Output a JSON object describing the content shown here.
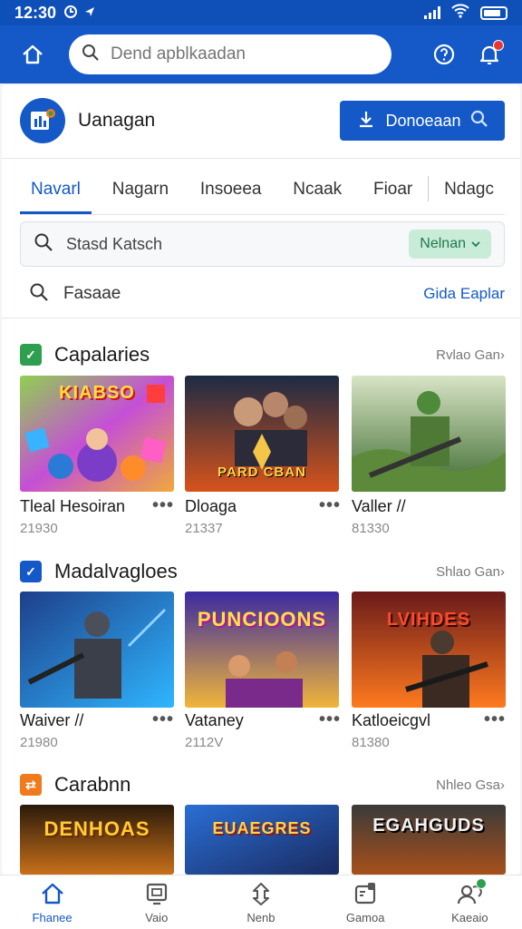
{
  "status_bar": {
    "time": "12:30",
    "accent": "#0e4fb8"
  },
  "app_bar": {
    "search_placeholder": "Dend apblkaadan",
    "icons": [
      "back-home-icon",
      "search-icon",
      "help-icon",
      "notification-icon"
    ]
  },
  "header": {
    "app_name": "Uanagan",
    "download_label": "Donoeaan"
  },
  "tabs": [
    "Navarl",
    "Nagarn",
    "Insoeea",
    "Ncaak",
    "Fioar",
    "Ndagc"
  ],
  "filter": {
    "placeholder": "Stasd Katsch",
    "chip_label": "Nelnan"
  },
  "row2": {
    "label": "Fasaae",
    "link": "Gida Eaplar"
  },
  "sections": [
    {
      "title": "Capalaries",
      "see_all": "Rvlao Gan›",
      "icon_color": "#2e9e4f",
      "games": [
        {
          "name": "Tleal Hesoiran",
          "count": "21930",
          "banner": "KIABSO"
        },
        {
          "name": "Dloaga",
          "count": "21337",
          "banner": "PARD CBAN"
        },
        {
          "name": "Valler //",
          "count": "81330",
          "banner": ""
        }
      ]
    },
    {
      "title": "Madalvagloes",
      "see_all": "Shlao Gan›",
      "icon_color": "#1459c7",
      "games": [
        {
          "name": "Waiver //",
          "count": "21980",
          "banner": ""
        },
        {
          "name": "Vataney",
          "count": "2112V",
          "banner": "PUNCIOONS"
        },
        {
          "name": "Katloeicgvl",
          "count": "81380",
          "banner": "LVIHDES"
        }
      ]
    },
    {
      "title": "Carabnn",
      "see_all": "Nhleo Gsa›",
      "icon_color": "#f07a1c",
      "games": [
        {
          "name": "",
          "count": "",
          "banner": "DENHOAS"
        },
        {
          "name": "",
          "count": "",
          "banner": "EUAEGRES"
        },
        {
          "name": "",
          "count": "",
          "banner": "EGAHGUDS"
        }
      ]
    }
  ],
  "bottom_nav": [
    {
      "label": "Fhanee",
      "icon": "home-icon",
      "active": true
    },
    {
      "label": "Vaio",
      "icon": "tv-icon",
      "active": false
    },
    {
      "label": "Nenb",
      "icon": "puzzle-icon",
      "active": false
    },
    {
      "label": "Gamoa",
      "icon": "gamepad-icon",
      "active": false
    },
    {
      "label": "Kaeaio",
      "icon": "profile-icon",
      "active": false
    }
  ]
}
